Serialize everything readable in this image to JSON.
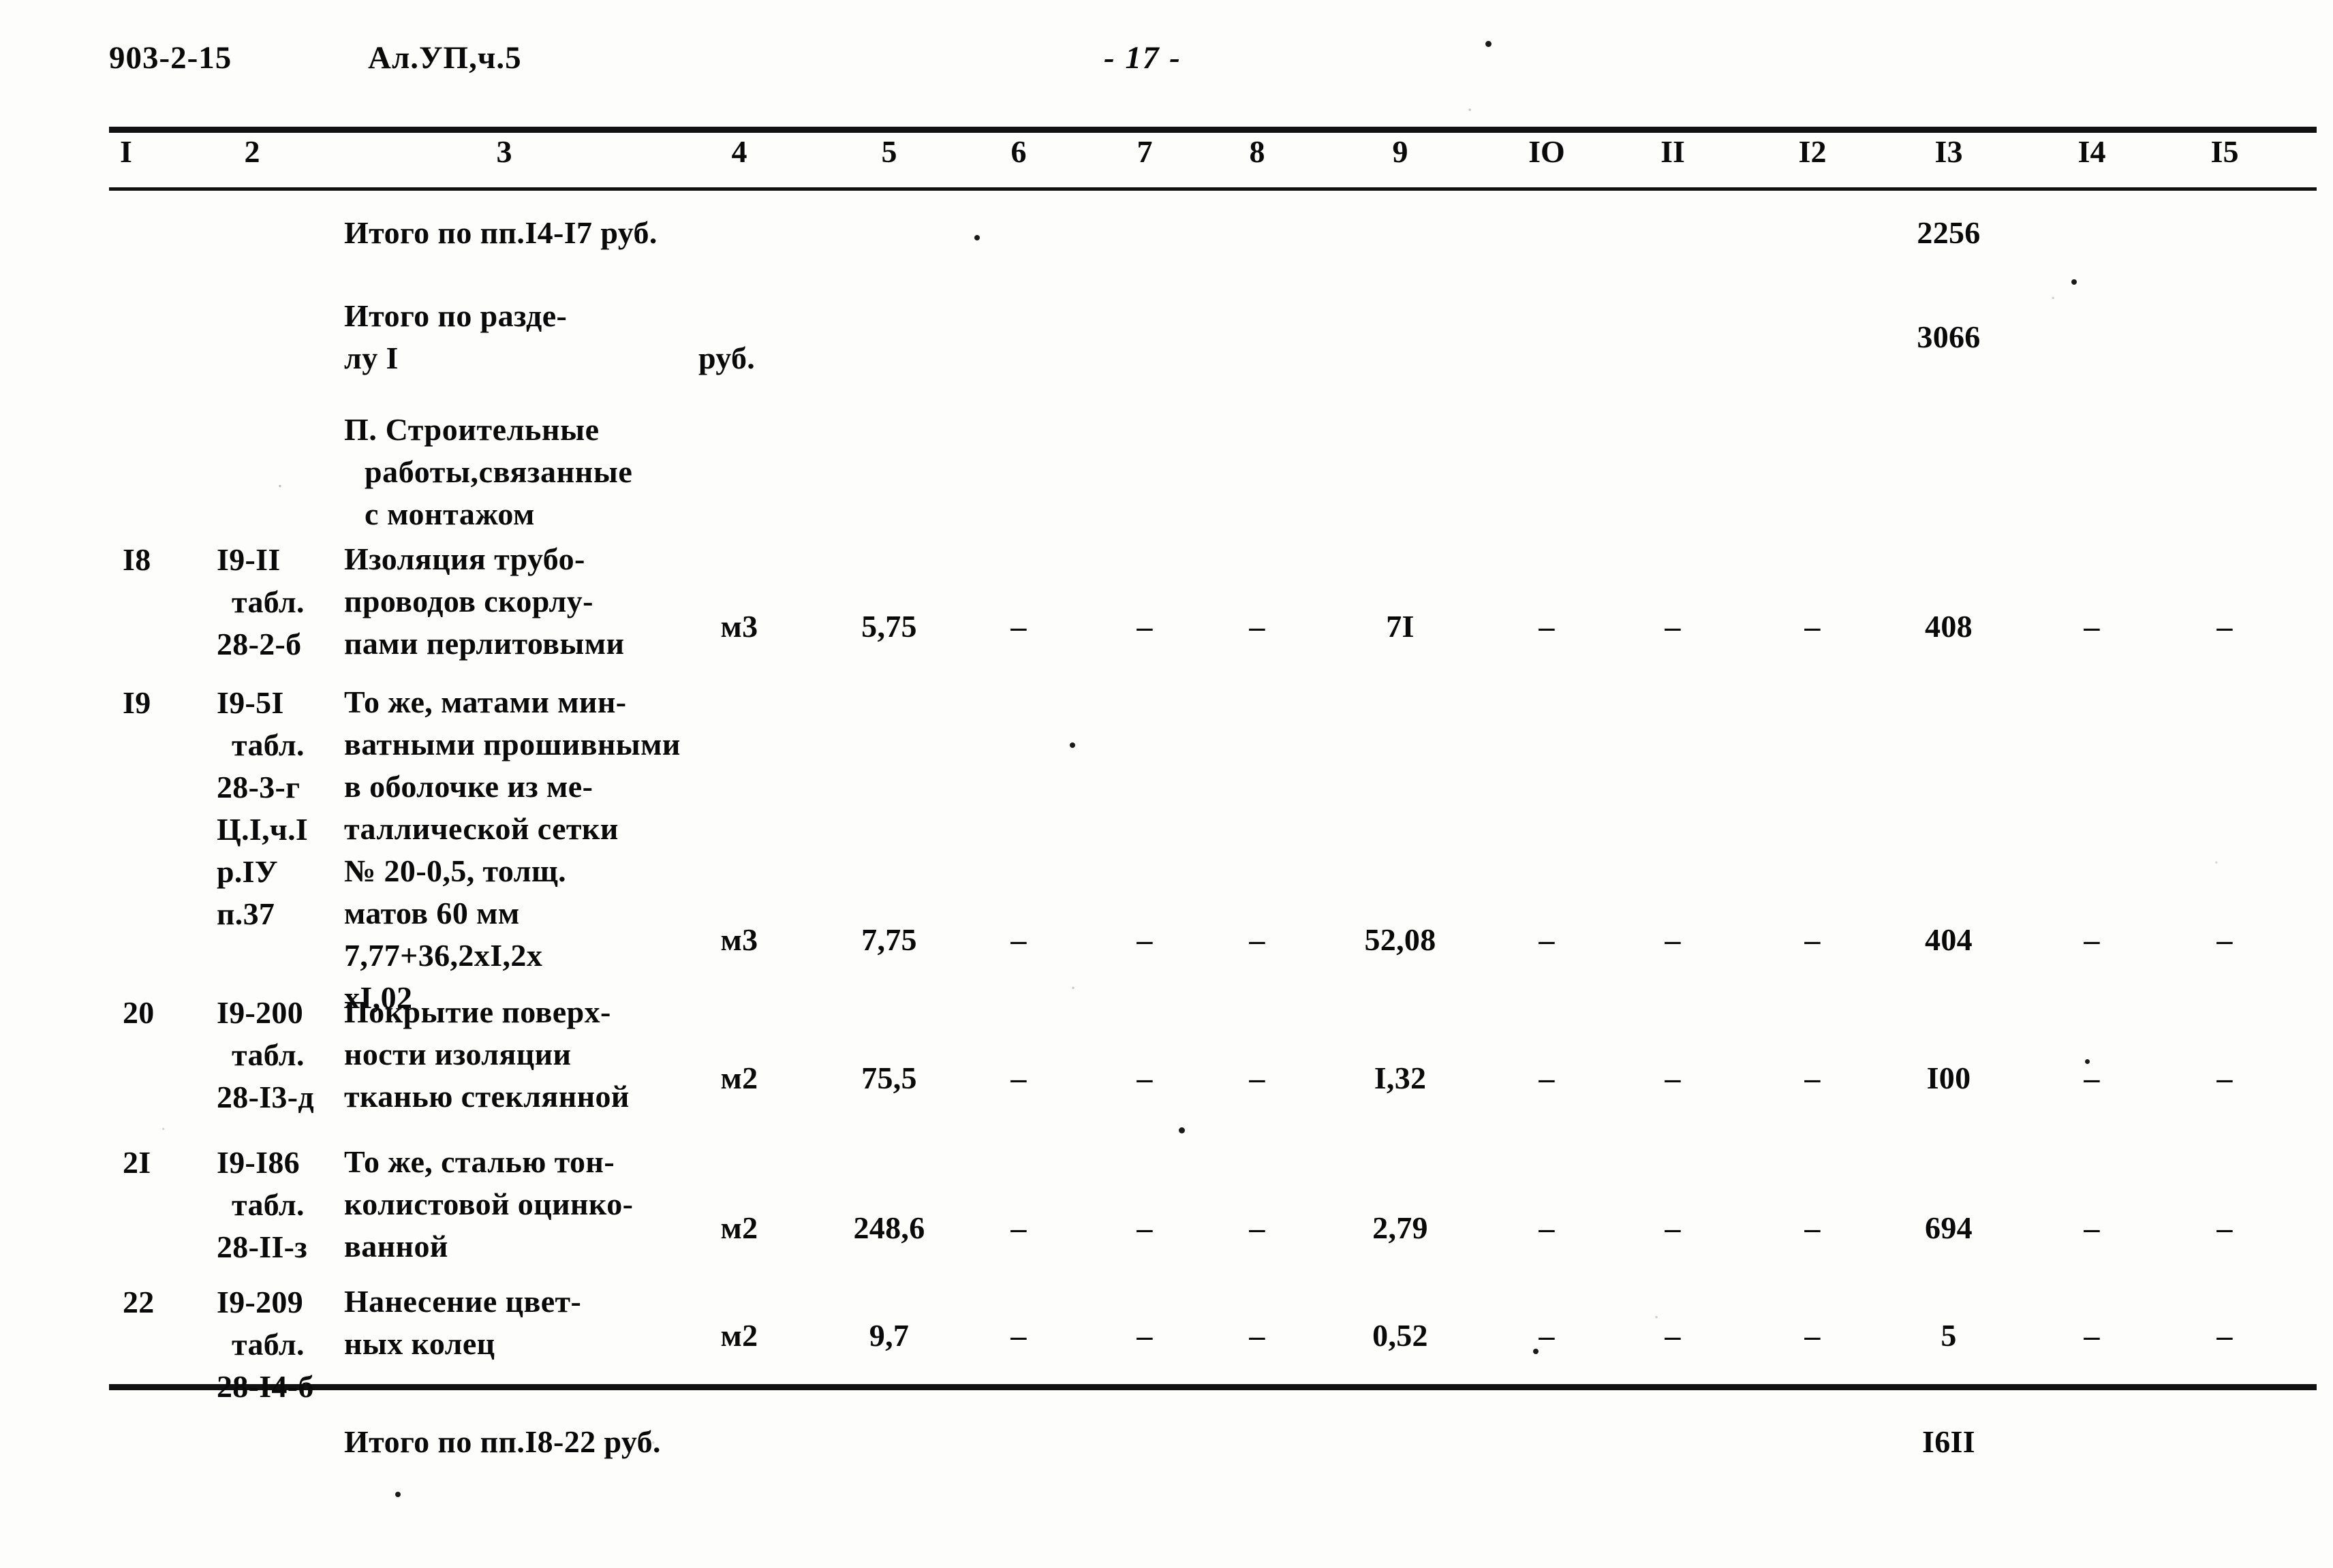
{
  "header": {
    "doc_code": "903-2-15",
    "album": "Ал.УП,ч.5",
    "page_marker": "- 17 -"
  },
  "table": {
    "column_numbers": [
      "I",
      "2",
      "3",
      "4",
      "5",
      "6",
      "7",
      "8",
      "9",
      "IO",
      "II",
      "I2",
      "I3",
      "I4",
      "I5"
    ],
    "totals_top": [
      {
        "label": "Итого по пп.I4-I7 руб.",
        "value_col13": "2256"
      },
      {
        "label_line1": "Итого по разде-",
        "label_line2": "лу I",
        "unit": "руб.",
        "value_col13": "3066"
      }
    ],
    "section_heading": {
      "line1": "П. Строительные",
      "line2": "работы,связанные",
      "line3": "с монтажом"
    },
    "rows": [
      {
        "no": "I8",
        "code_lines": [
          "I9-II",
          "табл.",
          "28-2-б"
        ],
        "description_lines": [
          "Изоляция трубо-",
          "проводов скорлу-",
          "пами перлитовыми"
        ],
        "unit": "м3",
        "qty": "5,75",
        "c6": "–",
        "c7": "–",
        "c8": "–",
        "c9": "7I",
        "c10": "–",
        "c11": "–",
        "c12": "–",
        "c13": "408",
        "c14": "–",
        "c15": "–"
      },
      {
        "no": "I9",
        "code_lines": [
          "I9-5I",
          "табл.",
          "28-3-г",
          "Ц.I,ч.I",
          "р.IУ",
          "п.37"
        ],
        "description_lines": [
          "То же, матами мин-",
          "ватными прошивными",
          "в оболочке из ме-",
          "таллической сетки",
          "№ 20-0,5, толщ.",
          "матов 60 мм",
          "7,77+36,2хI,2х",
          "хI,02"
        ],
        "unit": "м3",
        "qty": "7,75",
        "c6": "–",
        "c7": "–",
        "c8": "–",
        "c9": "52,08",
        "c10": "–",
        "c11": "–",
        "c12": "–",
        "c13": "404",
        "c14": "–",
        "c15": "–"
      },
      {
        "no": "20",
        "code_lines": [
          "I9-200",
          "табл.",
          "28-I3-д"
        ],
        "description_lines": [
          "Покрытие поверх-",
          "ности изоляции",
          "тканью стеклянной"
        ],
        "unit": "м2",
        "qty": "75,5",
        "c6": "–",
        "c7": "–",
        "c8": "–",
        "c9": "I,32",
        "c10": "–",
        "c11": "–",
        "c12": "–",
        "c13": "I00",
        "c14": "–",
        "c15": "–"
      },
      {
        "no": "2I",
        "code_lines": [
          "I9-I86",
          "табл.",
          "28-II-з"
        ],
        "description_lines": [
          "То же, сталью тон-",
          "колистовой оцинко-",
          "ванной"
        ],
        "unit": "м2",
        "qty": "248,6",
        "c6": "–",
        "c7": "–",
        "c8": "–",
        "c9": "2,79",
        "c10": "–",
        "c11": "–",
        "c12": "–",
        "c13": "694",
        "c14": "–",
        "c15": "–"
      },
      {
        "no": "22",
        "code_lines": [
          "I9-209",
          "табл.",
          "28-I4-б"
        ],
        "description_lines": [
          "Нанесение цвет-",
          "ных колец"
        ],
        "unit": "м2",
        "qty": "9,7",
        "c6": "–",
        "c7": "–",
        "c8": "–",
        "c9": "0,52",
        "c10": "–",
        "c11": "–",
        "c12": "–",
        "c13": "5",
        "c14": "–",
        "c15": "–"
      }
    ],
    "total_bottom": {
      "label": "Итого по пп.I8-22 руб.",
      "value_col13": "I6II"
    }
  }
}
